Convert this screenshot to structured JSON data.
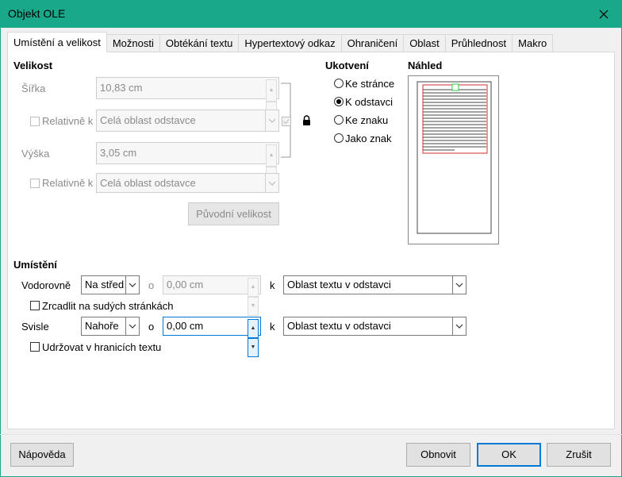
{
  "window": {
    "title": "Objekt OLE"
  },
  "tabs": [
    "Umístění a velikost",
    "Možnosti",
    "Obtékání textu",
    "Hypertextový odkaz",
    "Ohraničení",
    "Oblast",
    "Průhlednost",
    "Makro"
  ],
  "size": {
    "heading": "Velikost",
    "width_label": "Šířka",
    "width_value": "10,83 cm",
    "relative_label": "Relativně k",
    "relative_width_value": "Celá oblast odstavce",
    "height_label": "Výška",
    "height_value": "3,05 cm",
    "relative_height_value": "Celá oblast odstavce",
    "original_size_button": "Původní velikost"
  },
  "anchor": {
    "heading": "Ukotvení",
    "options": [
      "Ke stránce",
      "K odstavci",
      "Ke znaku",
      "Jako znak"
    ],
    "selected": "K odstavci"
  },
  "preview": {
    "heading": "Náhled"
  },
  "position": {
    "heading": "Umístění",
    "horizontal_label": "Vodorovně",
    "horizontal_value": "Na střed",
    "by_label": "o",
    "horizontal_by_value": "0,00 cm",
    "to_label": "k",
    "horizontal_to_value": "Oblast textu v odstavci",
    "mirror_label": "Zrcadlit na sudých stránkách",
    "vertical_label": "Svisle",
    "vertical_value": "Nahoře",
    "vertical_by_value": "0,00 cm",
    "vertical_to_value": "Oblast textu v odstavci",
    "keep_inside_label": "Udržovat v hranicích textu"
  },
  "buttons": {
    "help": "Nápověda",
    "reset": "Obnovit",
    "ok": "OK",
    "cancel": "Zrušit"
  },
  "colors": {
    "titlebar": "#1aa88a",
    "focus": "#0078d7",
    "preview_frame": "#d32f2f",
    "preview_handle": "#2ecc40"
  }
}
